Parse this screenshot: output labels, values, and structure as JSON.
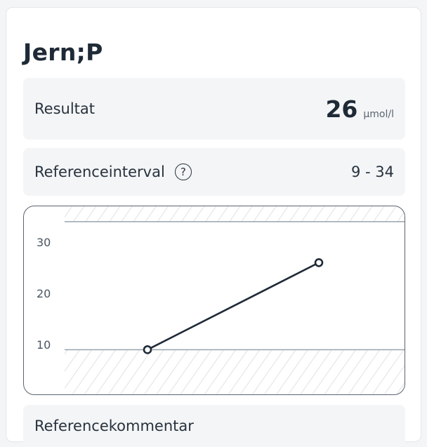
{
  "test": {
    "title": "Jern;P"
  },
  "result": {
    "label": "Resultat",
    "value": "26",
    "unit": "µmol/l"
  },
  "reference": {
    "label": "Referenceinterval",
    "help_icon": "question-circle-icon",
    "value": "9 - 34"
  },
  "chart_data": {
    "type": "line",
    "y_ticks": [
      "10",
      "20",
      "30"
    ],
    "ylim": [
      0,
      37
    ],
    "reference_range": [
      9,
      34
    ],
    "series": [
      {
        "values": [
          9,
          26
        ]
      }
    ],
    "grid": false,
    "colors": {
      "line": "#1f2a37",
      "reference_line": "#9aa3ad",
      "hatch": "#c9ced4"
    }
  },
  "next_section": {
    "label": "Referencekommentar"
  }
}
